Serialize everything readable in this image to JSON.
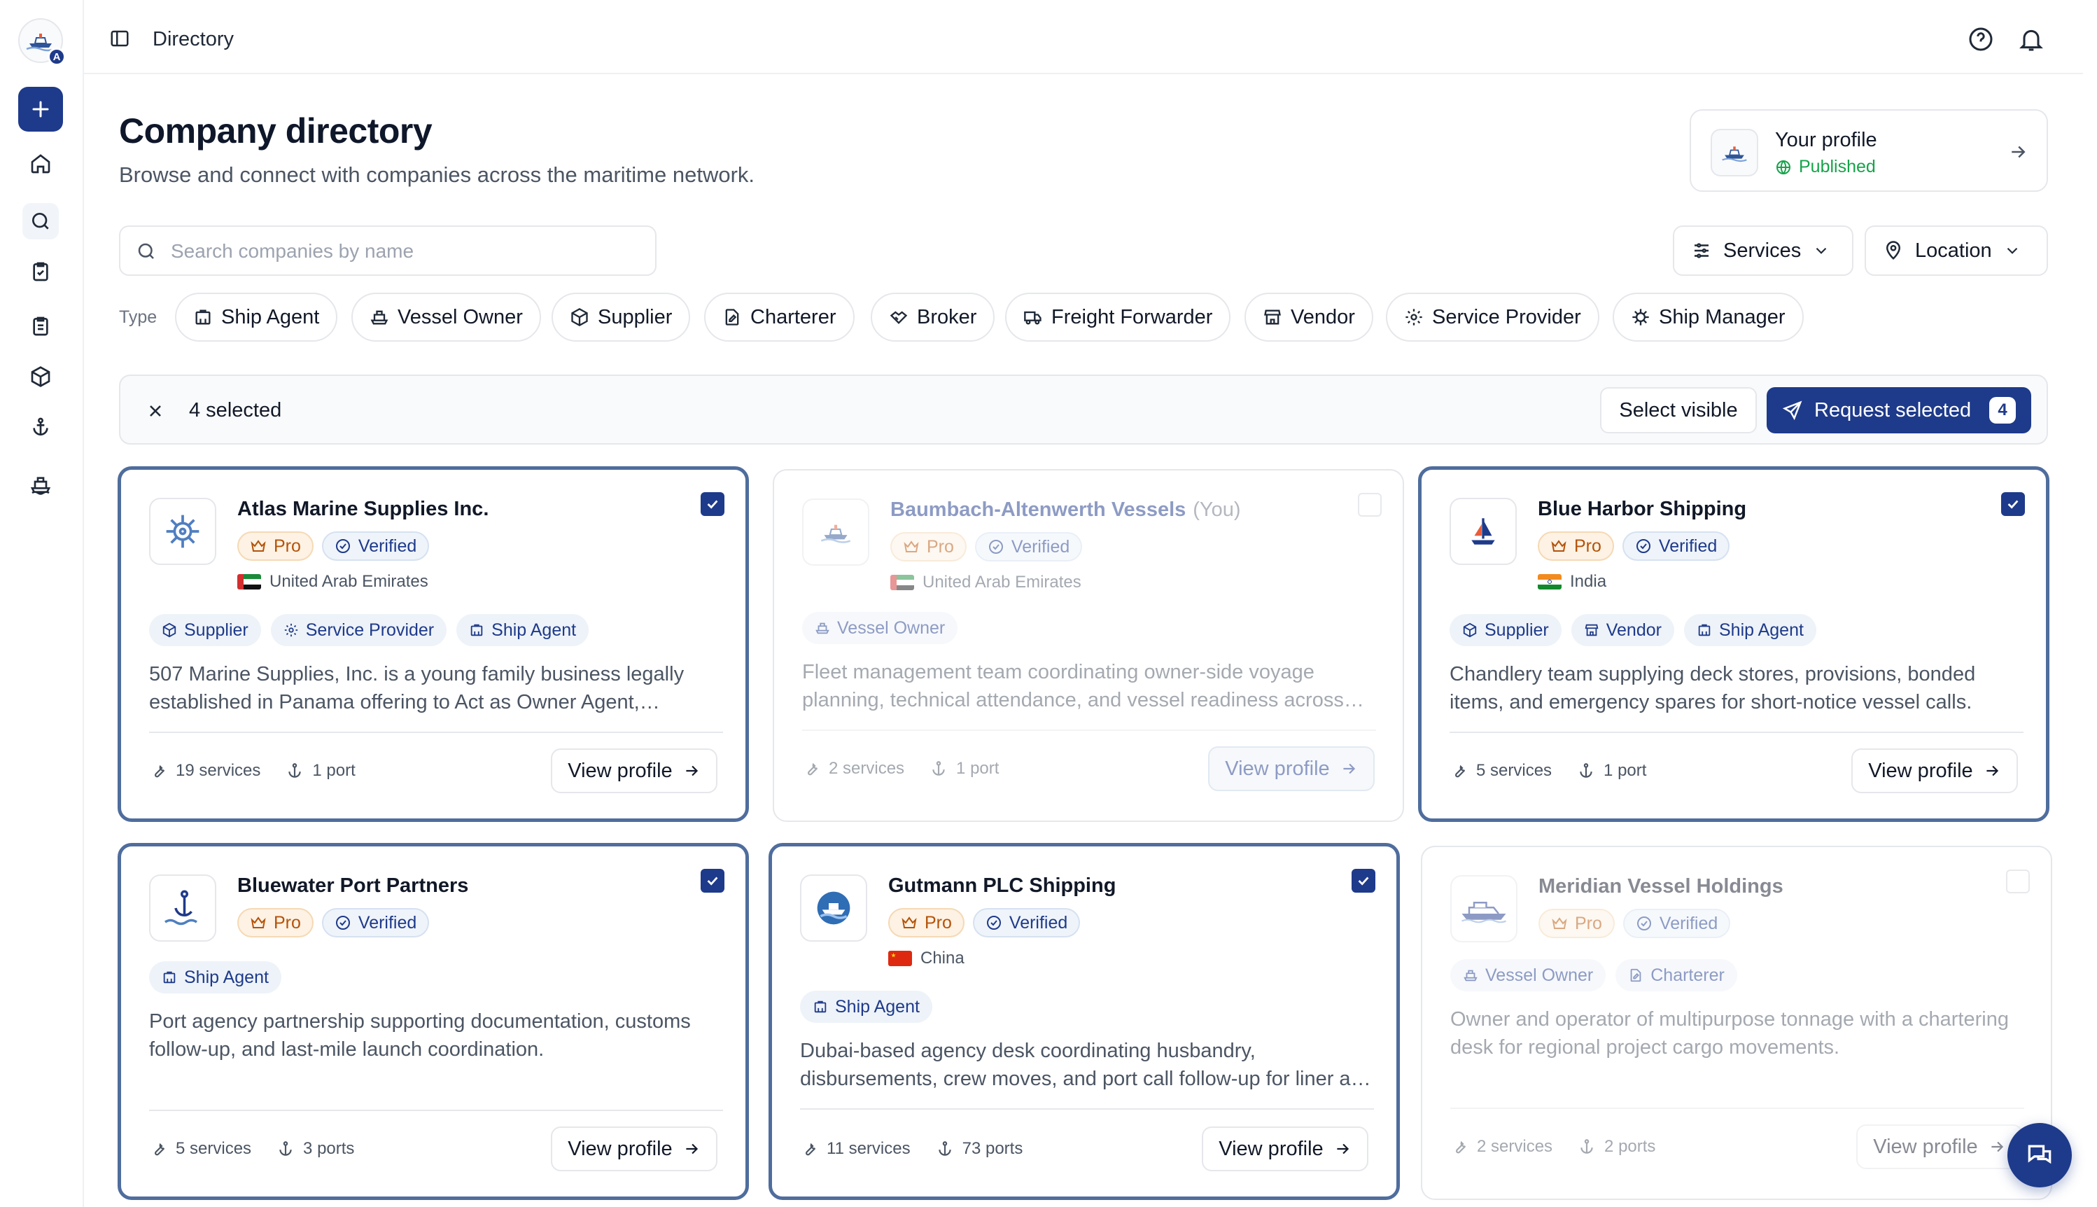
{
  "topbar": {
    "breadcrumb": "Directory"
  },
  "header": {
    "title": "Company directory",
    "subtitle": "Browse and connect with companies across the maritime network."
  },
  "profile": {
    "title": "Your profile",
    "status": "Published"
  },
  "search": {
    "placeholder": "Search companies by name",
    "value": ""
  },
  "filters": {
    "services_label": "Services",
    "location_label": "Location"
  },
  "types": {
    "label": "Type",
    "items": [
      "Ship Agent",
      "Vessel Owner",
      "Supplier",
      "Charterer",
      "Broker",
      "Freight Forwarder",
      "Vendor",
      "Service Provider",
      "Ship Manager"
    ]
  },
  "selection": {
    "count_text": "4 selected",
    "select_visible_label": "Select visible",
    "request_label": "Request selected",
    "request_count": "4"
  },
  "cards": [
    {
      "name": "Atlas Marine Supplies Inc.",
      "you": "",
      "pro": "Pro",
      "verified": "Verified",
      "country": "United Arab Emirates",
      "tags": [
        "Supplier",
        "Service Provider",
        "Ship Agent"
      ],
      "description": "507 Marine Supplies, Inc. is a young family business legally established in Panama offering to Act as Owner Agent, Shipchandling, Technical Services and more.",
      "services": "19 services",
      "ports": "1 port",
      "view": "View profile"
    },
    {
      "name": "Baumbach-Altenwerth Vessels",
      "you": "(You)",
      "pro": "Pro",
      "verified": "Verified",
      "country": "United Arab Emirates",
      "tags": [
        "Vessel Owner"
      ],
      "description": "Fleet management team coordinating owner-side voyage planning, technical attendance, and vessel readiness across the region.",
      "services": "2 services",
      "ports": "1 port",
      "view": "View profile"
    },
    {
      "name": "Blue Harbor Shipping",
      "you": "",
      "pro": "Pro",
      "verified": "Verified",
      "country": "India",
      "tags": [
        "Supplier",
        "Vendor",
        "Ship Agent"
      ],
      "description": "Chandlery team supplying deck stores, provisions, bonded items, and emergency spares for short-notice vessel calls.",
      "services": "5 services",
      "ports": "1 port",
      "view": "View profile"
    },
    {
      "name": "Bluewater Port Partners",
      "you": "",
      "pro": "Pro",
      "verified": "Verified",
      "country": "",
      "tags": [
        "Ship Agent"
      ],
      "description": "Port agency partnership supporting documentation, customs follow-up, and last-mile launch coordination.",
      "services": "5 services",
      "ports": "3 ports",
      "view": "View profile"
    },
    {
      "name": "Gutmann PLC Shipping",
      "you": "",
      "pro": "Pro",
      "verified": "Verified",
      "country": "China",
      "tags": [
        "Ship Agent"
      ],
      "description": "Dubai-based agency desk coordinating husbandry, disbursements, crew moves, and port call follow-up for liner and tramp operators.",
      "services": "11 services",
      "ports": "73 ports",
      "view": "View profile"
    },
    {
      "name": "Meridian Vessel Holdings",
      "you": "",
      "pro": "Pro",
      "verified": "Verified",
      "country": "",
      "tags": [
        "Vessel Owner",
        "Charterer"
      ],
      "description": "Owner and operator of multipurpose tonnage with a chartering desk for regional project cargo movements.",
      "services": "2 services",
      "ports": "2 ports",
      "view": "View profile"
    }
  ],
  "colors": {
    "accent": "#1e3a8a",
    "selected_border": "#4f6d9d",
    "pro": "#b45309",
    "published": "#16a34a"
  }
}
